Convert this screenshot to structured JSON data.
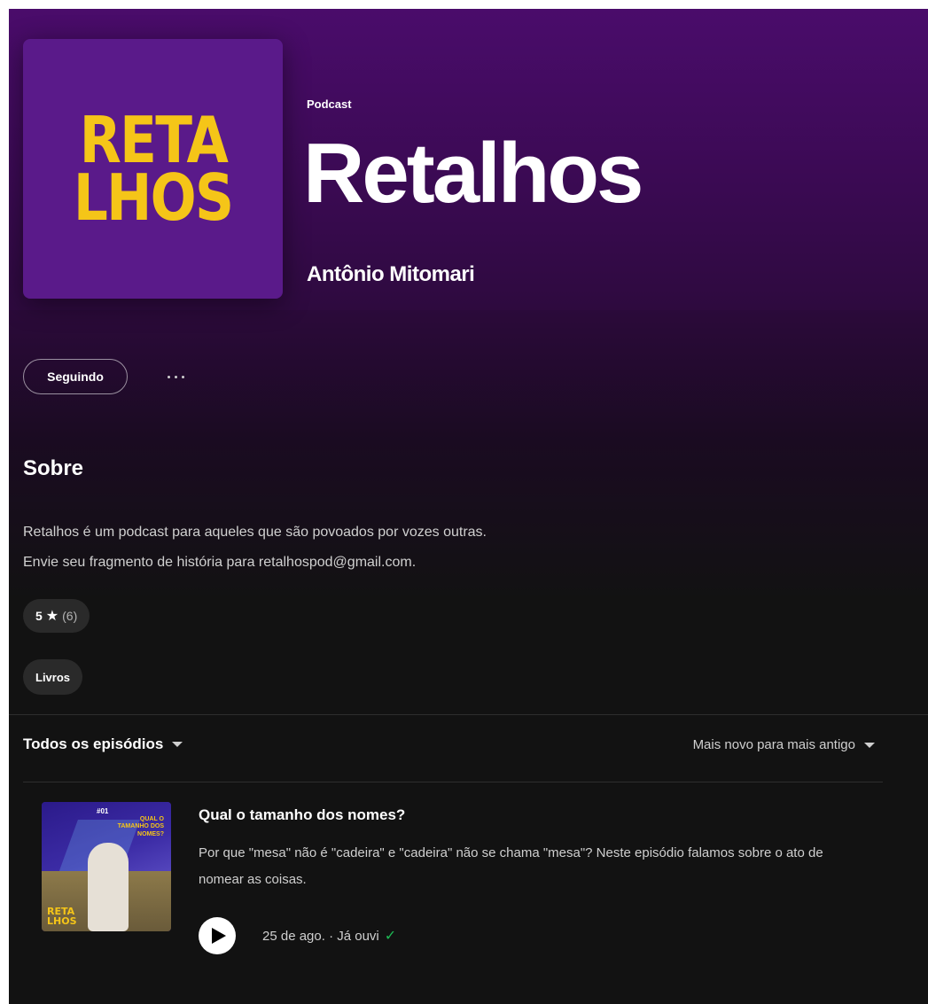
{
  "podcast": {
    "type_label": "Podcast",
    "title": "Retalhos",
    "author": "Antônio Mitomari",
    "cover_logo_lines": [
      "RETA",
      "LHOS"
    ],
    "colors": {
      "hero": "#4a0c6b",
      "logo": "#f5c518",
      "background": "#121212"
    }
  },
  "actions": {
    "follow_label": "Seguindo",
    "more_icon": "more-options-icon"
  },
  "about": {
    "heading": "Sobre",
    "line1": "Retalhos é um podcast para aqueles que são povoados por vozes outras.",
    "line2": "Envie seu fragmento de história para retalhospod@gmail.com.",
    "rating_value": "5",
    "rating_count": "(6)",
    "category": "Livros"
  },
  "episodes": {
    "filter_label": "Todos os episódios",
    "sort_label": "Mais novo para mais antigo",
    "items": [
      {
        "thumb_number": "#01",
        "thumb_tag": "QUAL O TAMANHO DOS NOMES?",
        "thumb_logo": [
          "RETA",
          "LHOS"
        ],
        "title": "Qual o tamanho dos nomes?",
        "description": "Por que \"mesa\" não é \"cadeira\" e \"cadeira\" não se chama \"mesa\"? Neste episódio falamos sobre o ato de nomear as coisas.",
        "meta": "25 de ago. · Já ouvi"
      }
    ]
  }
}
